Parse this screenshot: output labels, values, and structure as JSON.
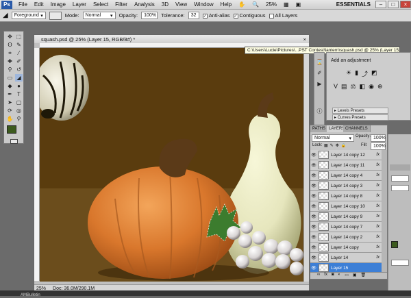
{
  "menubar": {
    "logo": "Ps",
    "items": [
      "File",
      "Edit",
      "Image",
      "Layer",
      "Select",
      "Filter",
      "Analysis",
      "3D",
      "View",
      "Window",
      "Help"
    ],
    "zoom": "25%",
    "workspace": "ESSENTIALS"
  },
  "options": {
    "preset": "Foreground",
    "mode_label": "Mode:",
    "mode_value": "Normal",
    "opacity_label": "Opacity:",
    "opacity_value": "100%",
    "tolerance_label": "Tolerance:",
    "tolerance_value": "32",
    "antialias": "Anti-alias",
    "contiguous": "Contiguous",
    "all_layers": "All Layers"
  },
  "document": {
    "title": "squash.psd @ 25% (Layer 15, RGB/8#) *",
    "tooltip": "C:\\Users\\Lucie\\Pictures\\...PST Contest\\lantern\\squash.psd @ 25% (Layer 15, RGB/8#) *",
    "zoom": "25%",
    "doc_size": "Doc: 36.0M/290.1M"
  },
  "adjustments": {
    "title": "Add an adjustment",
    "presets": [
      "Levels Presets",
      "Curves Presets"
    ]
  },
  "layers": {
    "tabs": [
      "PATHS",
      "LAYERS",
      "CHANNELS"
    ],
    "blend": "Normal",
    "opacity_label": "Opacity:",
    "opacity_value": "100%",
    "lock_label": "Lock:",
    "fill_label": "Fill:",
    "fill_value": "100%",
    "items": [
      {
        "name": "Layer 14 copy 12",
        "active": false
      },
      {
        "name": "Layer 14 copy 11",
        "active": false
      },
      {
        "name": "Layer 14 copy 4",
        "active": false
      },
      {
        "name": "Layer 14 copy 3",
        "active": false
      },
      {
        "name": "Layer 14 copy 8",
        "active": false
      },
      {
        "name": "Layer 14 copy 10",
        "active": false
      },
      {
        "name": "Layer 14 copy 9",
        "active": false
      },
      {
        "name": "Layer 14 copy 7",
        "active": false
      },
      {
        "name": "Layer 14 copy 2",
        "active": false
      },
      {
        "name": "Layer 14 copy",
        "active": false
      },
      {
        "name": "Layer 14",
        "active": false
      },
      {
        "name": "Layer 15",
        "active": true
      }
    ],
    "fx_label": "fx"
  },
  "colors": {
    "canvas_bg": "#5a3c0e",
    "table": "#6b4d1c",
    "pumpkin": "#d9772c",
    "squash": "#e6e6bd",
    "leaf": "#3c7c2e",
    "accent_selection": "#3d7fd6"
  },
  "taskbar": {
    "text": "AMBulletin"
  }
}
